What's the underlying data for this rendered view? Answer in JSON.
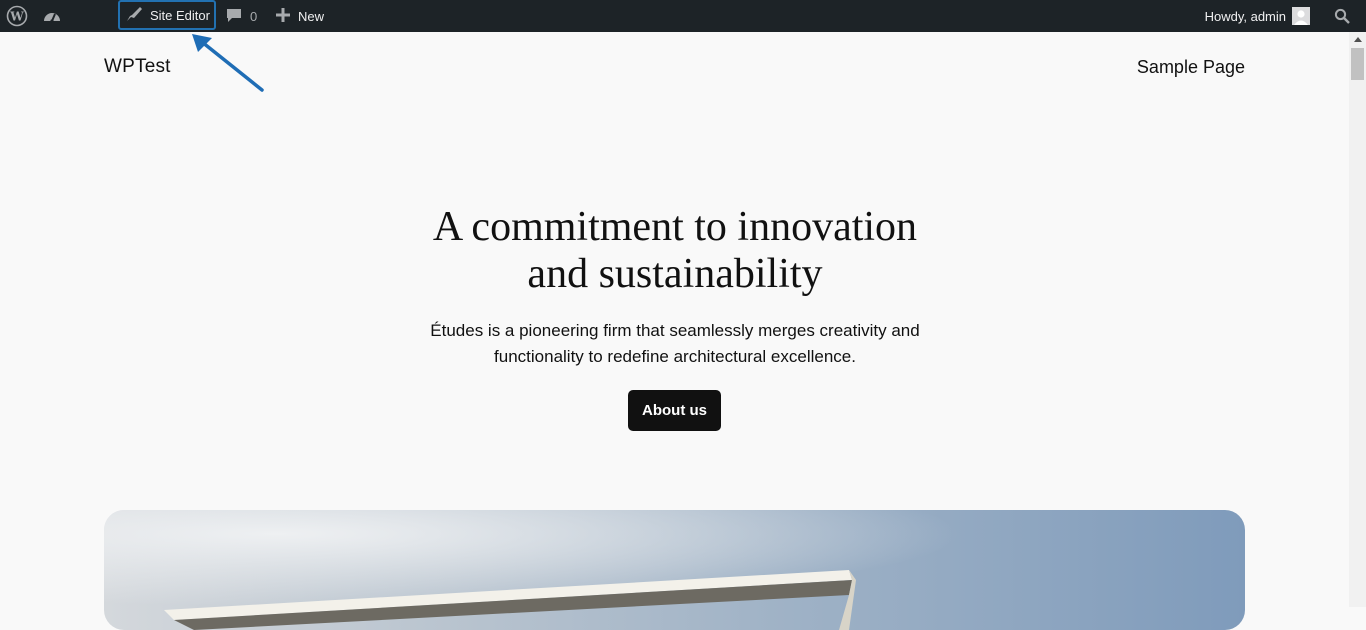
{
  "admin_bar": {
    "site_editor_label": "Site Editor",
    "comments_count": "0",
    "new_label": "New",
    "howdy_label": "Howdy, admin",
    "icons": [
      "wordpress-logo-icon",
      "dashboard-icon",
      "brush-icon",
      "comment-icon",
      "plus-icon",
      "avatar-icon",
      "search-icon"
    ]
  },
  "site": {
    "title": "WPTest",
    "nav": [
      {
        "label": "Sample Page"
      }
    ]
  },
  "hero": {
    "title_line1": "A commitment to innovation",
    "title_line2": "and sustainability",
    "text_line1": "Études is a pioneering firm that seamlessly merges creativity and",
    "text_line2": "functionality to redefine architectural excellence.",
    "button_label": "About us"
  },
  "colors": {
    "admin_bar_bg": "#1d2327",
    "highlight": "#2271b1",
    "button_bg": "#111111",
    "page_bg": "#f9f9f9"
  }
}
